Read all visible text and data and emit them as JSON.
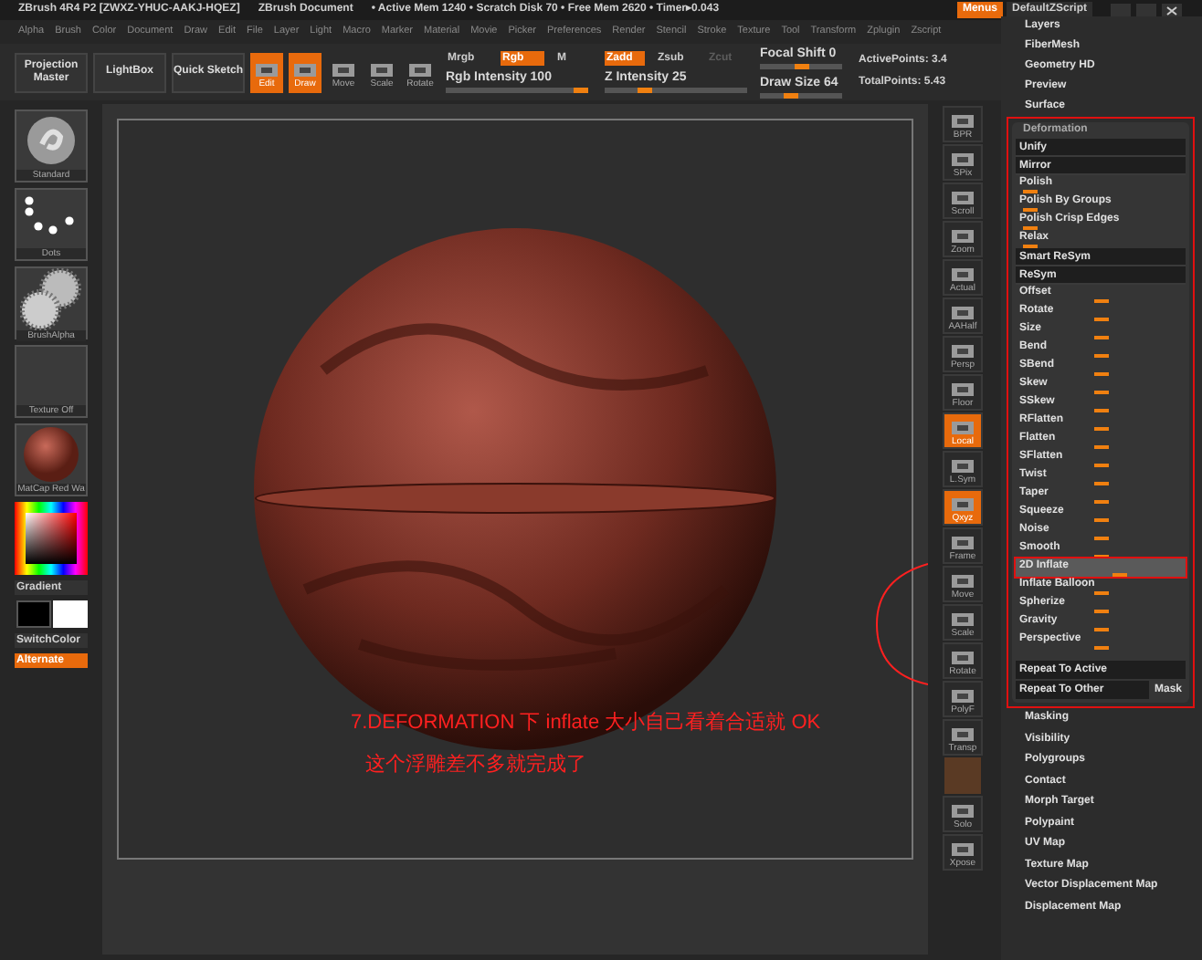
{
  "title_bar": {
    "app": "ZBrush 4R4 P2 [ZWXZ-YHUC-AAKJ-HQEZ]",
    "document": "ZBrush Document",
    "stats": "• Active Mem 1240 • Scratch Disk 70 • Free Mem 2620 • Timer▸0.043",
    "buttons": [
      {
        "label": "Menus",
        "on": true
      },
      {
        "label": "DefaultZScript",
        "on": false
      }
    ]
  },
  "menu": [
    "Alpha",
    "Brush",
    "Color",
    "Document",
    "Draw",
    "Edit",
    "File",
    "Layer",
    "Light",
    "Macro",
    "Marker",
    "Material",
    "Movie",
    "Picker",
    "Preferences",
    "Render",
    "Stencil",
    "Stroke",
    "Texture",
    "Tool",
    "Transform",
    "Zplugin",
    "Zscript"
  ],
  "shelf": {
    "big_buttons": [
      "Projection Master",
      "LightBox",
      "Quick Sketch"
    ],
    "modes": [
      {
        "label": "Edit",
        "on": true
      },
      {
        "label": "Draw",
        "on": true
      },
      {
        "label": "Move",
        "on": false
      },
      {
        "label": "Scale",
        "on": false
      },
      {
        "label": "Rotate",
        "on": false
      }
    ],
    "rgb_toggles": [
      {
        "label": "Mrgb",
        "on": false
      },
      {
        "label": "Rgb",
        "on": true
      },
      {
        "label": "M",
        "on": false
      }
    ],
    "z_toggles": [
      {
        "label": "Zadd",
        "on": true,
        "disabled": false
      },
      {
        "label": "Zsub",
        "on": false,
        "disabled": false
      },
      {
        "label": "Zcut",
        "on": false,
        "disabled": true
      }
    ],
    "sliders": [
      {
        "label": "Rgb Intensity 100",
        "level": 1
      },
      {
        "label": "Z Intensity 25",
        "level": 0.25
      },
      {
        "label": "Focal Shift 0",
        "level": 0.5
      },
      {
        "label": "Draw Size 64",
        "level": 0.35
      }
    ],
    "stats": [
      "ActivePoints: 3.4",
      "TotalPoints: 5.43"
    ]
  },
  "left_panel": {
    "thumbnails": [
      {
        "kind": "brush",
        "caption": "Standard"
      },
      {
        "kind": "stroke",
        "caption": "Dots"
      },
      {
        "kind": "alpha",
        "caption": "BrushAlpha"
      },
      {
        "kind": "texture",
        "caption": "Texture Off"
      },
      {
        "kind": "material",
        "caption": "MatCap Red Wa"
      }
    ],
    "gradient": "Gradient",
    "switch_color": "SwitchColor",
    "alternate": {
      "label": "Alternate",
      "on": true
    }
  },
  "canvas": {
    "annotations": [
      "7.DEFORMATION 下 inflate 大小自己看着合适就 OK",
      "这个浮雕差不多就完成了"
    ]
  },
  "right_toolbar": [
    {
      "label": "BPR",
      "on": false
    },
    {
      "label": "SPix",
      "on": false
    },
    {
      "label": "Scroll",
      "on": false
    },
    {
      "label": "Zoom",
      "on": false
    },
    {
      "label": "Actual",
      "on": false
    },
    {
      "label": "AAHalf",
      "on": false
    },
    {
      "label": "Persp",
      "on": false
    },
    {
      "label": "Floor",
      "on": false
    },
    {
      "label": "Local",
      "on": true
    },
    {
      "label": "L.Sym",
      "on": false
    },
    {
      "label": "Qxyz",
      "on": true
    },
    {
      "label": "Frame",
      "on": false
    },
    {
      "label": "Move",
      "on": false
    },
    {
      "label": "Scale",
      "on": false
    },
    {
      "label": "Rotate",
      "on": false
    },
    {
      "label": "PolyF",
      "on": false
    },
    {
      "label": "Transp",
      "on": false
    },
    {
      "label": "Solo",
      "on": false
    },
    {
      "label": "Xpose",
      "on": false
    }
  ],
  "tool_panel": {
    "top_items": [
      "Layers",
      "FiberMesh",
      "Geometry HD",
      "Preview",
      "Surface"
    ],
    "deformation": {
      "title": "Deformation",
      "items": [
        {
          "kind": "button",
          "label": "Unify"
        },
        {
          "kind": "button",
          "label": "Mirror"
        },
        {
          "kind": "slider",
          "label": "Polish",
          "level": 0.05,
          "selected": false
        },
        {
          "kind": "slider",
          "label": "Polish By Groups",
          "level": 0.05,
          "selected": false
        },
        {
          "kind": "slider",
          "label": "Polish Crisp Edges",
          "level": 0.05,
          "selected": false
        },
        {
          "kind": "slider",
          "label": "Relax",
          "level": 0.05,
          "selected": false
        },
        {
          "kind": "button",
          "label": "Smart ReSym"
        },
        {
          "kind": "button",
          "label": "ReSym"
        },
        {
          "kind": "slider",
          "label": "Offset",
          "level": 0.5,
          "selected": false
        },
        {
          "kind": "slider",
          "label": "Rotate",
          "level": 0.5,
          "selected": false
        },
        {
          "kind": "slider",
          "label": "Size",
          "level": 0.5,
          "selected": false
        },
        {
          "kind": "slider",
          "label": "Bend",
          "level": 0.5,
          "selected": false
        },
        {
          "kind": "slider",
          "label": "SBend",
          "level": 0.5,
          "selected": false
        },
        {
          "kind": "slider",
          "label": "Skew",
          "level": 0.5,
          "selected": false
        },
        {
          "kind": "slider",
          "label": "SSkew",
          "level": 0.5,
          "selected": false
        },
        {
          "kind": "slider",
          "label": "RFlatten",
          "level": 0.5,
          "selected": false
        },
        {
          "kind": "slider",
          "label": "Flatten",
          "level": 0.5,
          "selected": false
        },
        {
          "kind": "slider",
          "label": "SFlatten",
          "level": 0.5,
          "selected": false
        },
        {
          "kind": "slider",
          "label": "Twist",
          "level": 0.5,
          "selected": false
        },
        {
          "kind": "slider",
          "label": "Taper",
          "level": 0.5,
          "selected": false
        },
        {
          "kind": "slider",
          "label": "Squeeze",
          "level": 0.5,
          "selected": false
        },
        {
          "kind": "slider",
          "label": "Noise",
          "level": 0.5,
          "selected": false
        },
        {
          "kind": "slider",
          "label": "Smooth",
          "level": 0.5,
          "selected": false
        },
        {
          "kind": "slider",
          "label": "2D Inflate",
          "level": 0.62,
          "selected": true
        },
        {
          "kind": "slider",
          "label": "Inflate Balloon",
          "level": 0.5,
          "selected": false
        },
        {
          "kind": "slider",
          "label": "Spherize",
          "level": 0.5,
          "selected": false
        },
        {
          "kind": "slider",
          "label": "Gravity",
          "level": 0.5,
          "selected": false
        },
        {
          "kind": "slider",
          "label": "Perspective",
          "level": 0.5,
          "selected": false
        }
      ],
      "repeat_active": "Repeat To Active",
      "repeat_other": "Repeat To Other",
      "mask": "Mask"
    },
    "bottom_items": [
      "Masking",
      "Visibility",
      "Polygroups",
      "Contact",
      "Morph Target",
      "Polypaint",
      "UV Map",
      "Texture Map",
      "Vector Displacement Map",
      "Displacement Map"
    ]
  }
}
